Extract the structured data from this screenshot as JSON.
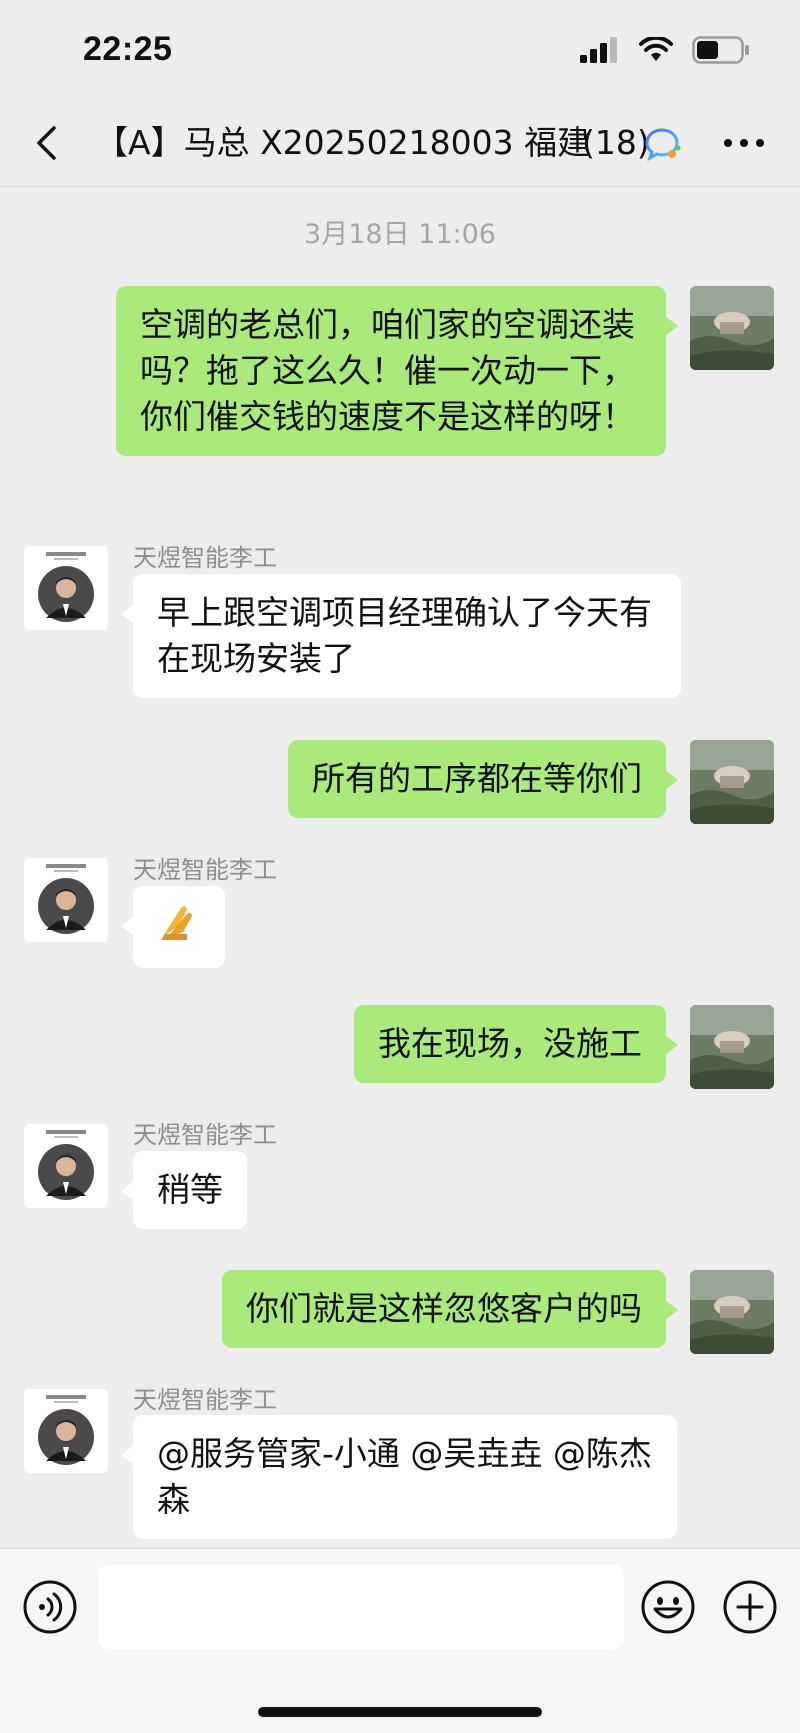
{
  "status_bar": {
    "time": "22:25",
    "battery_level": 0.5
  },
  "nav": {
    "title": "【A】马总 X20250218003 福建",
    "member_count": "(18)",
    "back_icon": "chevron-left-icon",
    "ai_icon": "ai-search-icon",
    "more_icon": "more-icon"
  },
  "chat": {
    "timestamp": "3月18日 11:06",
    "messages": [
      {
        "side": "me",
        "text": "空调的老总们，咱们家的空调还装吗？拖了这么久！催一次动一下，你们催交钱的速度不是这样的呀！"
      },
      {
        "side": "other",
        "sender": "天煜智能李工",
        "text": "早上跟空调项目经理确认了今天有在现场安装了"
      },
      {
        "side": "me",
        "text": "所有的工序都在等你们"
      },
      {
        "side": "other",
        "sender": "天煜智能李工",
        "text": "🙏",
        "emoji": "praying-hands"
      },
      {
        "side": "me",
        "text": "我在现场，没施工"
      },
      {
        "side": "other",
        "sender": "天煜智能李工",
        "text": "稍等"
      },
      {
        "side": "me",
        "text": "你们就是这样忽悠客户的吗"
      },
      {
        "side": "other",
        "sender": "天煜智能李工",
        "text": "@服务管家-小通 @吴垚垚 @陈杰森"
      }
    ]
  },
  "input_bar": {
    "voice_icon": "voice-icon",
    "emoji_icon": "emoji-icon",
    "plus_icon": "plus-icon",
    "input_value": ""
  },
  "colors": {
    "my_bubble": "#a9ea7a",
    "other_bubble": "#ffffff",
    "background": "#ededed"
  }
}
